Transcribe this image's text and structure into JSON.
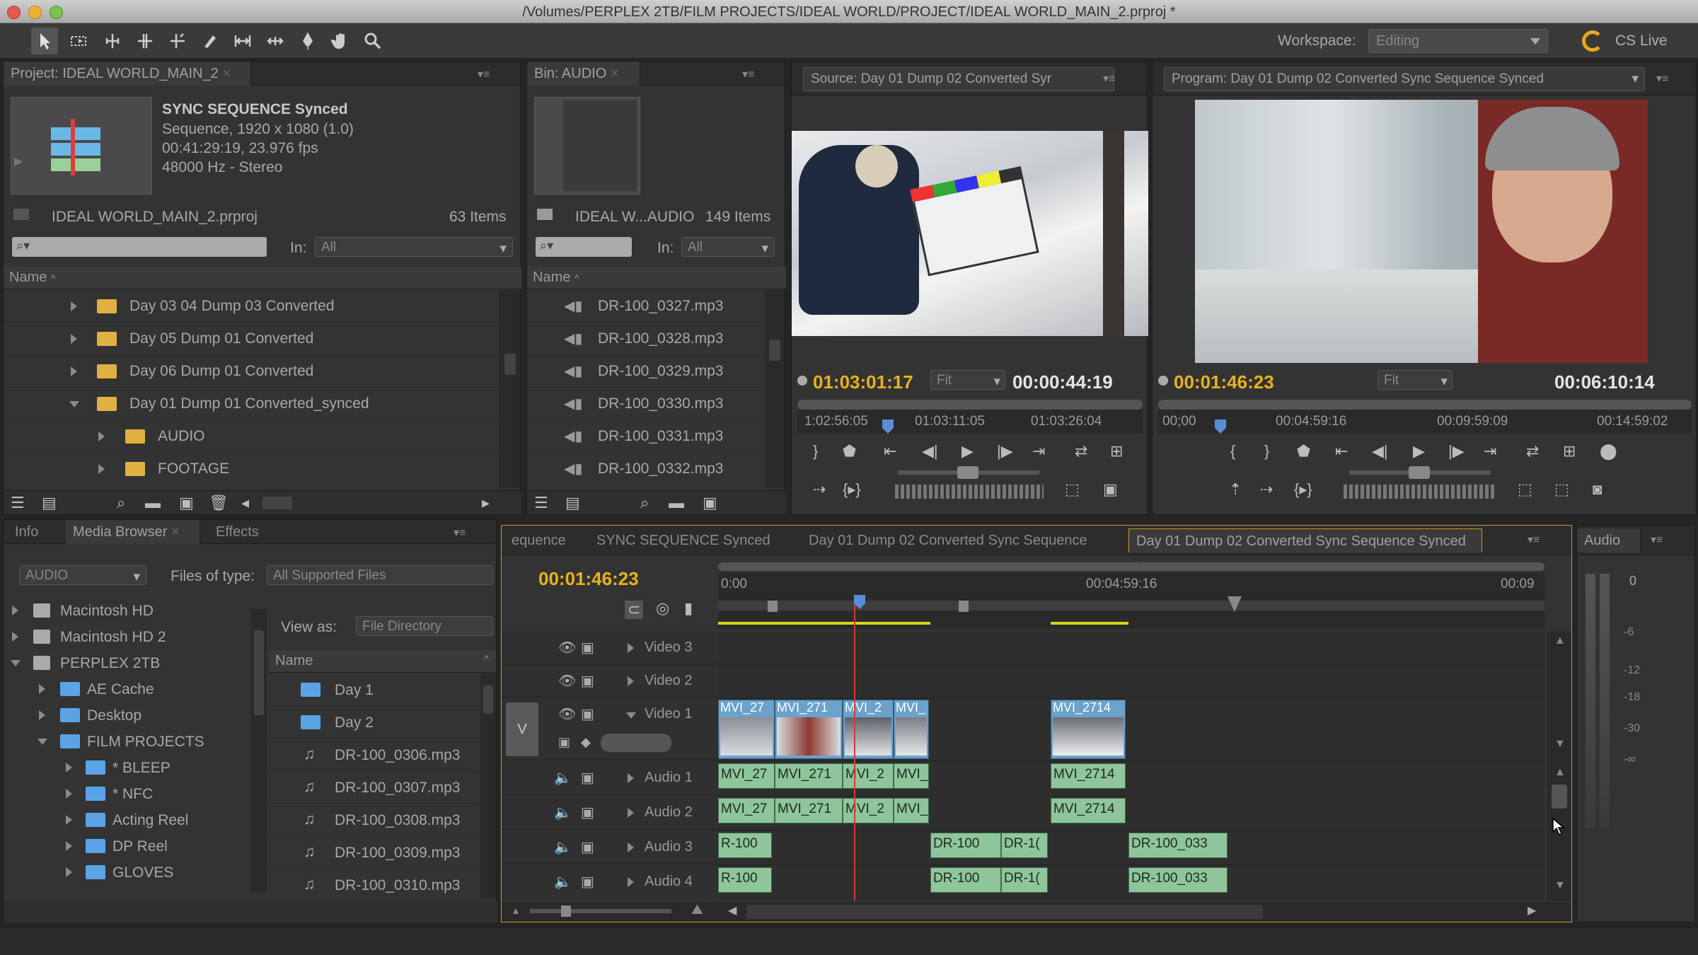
{
  "window": {
    "title": "/Volumes/PERPLEX 2TB/FILM PROJECTS/IDEAL WORLD/PROJECT/IDEAL WORLD_MAIN_2.prproj *"
  },
  "toolbar": {
    "tools": [
      "selection-tool",
      "track-select-tool",
      "ripple-edit-tool",
      "rolling-edit-tool",
      "rate-stretch-tool",
      "razor-tool",
      "slip-tool",
      "slide-tool",
      "pen-tool",
      "hand-tool",
      "zoom-tool"
    ],
    "workspace_label": "Workspace:",
    "workspace_value": "Editing",
    "cslive_label": "CS Live"
  },
  "project": {
    "tab": "Project: IDEAL WORLD_MAIN_2",
    "clip_name": "SYNC SEQUENCE Synced",
    "clip_info_1": "Sequence, 1920 x 1080 (1.0)",
    "clip_info_2": "00:41:29:19, 23.976 fps",
    "clip_info_3": "48000 Hz - Stereo",
    "file_name": "IDEAL WORLD_MAIN_2.prproj",
    "item_count": "63 Items",
    "in_label": "In:",
    "in_value": "All",
    "col_name": "Name",
    "items": [
      {
        "label": "Day 03 04 Dump 03 Converted"
      },
      {
        "label": "Day 05 Dump 01 Converted"
      },
      {
        "label": "Day 06 Dump 01 Converted"
      },
      {
        "label": "Day 01 Dump 01 Converted_synced"
      },
      {
        "label": "AUDIO"
      },
      {
        "label": "FOOTAGE"
      }
    ]
  },
  "bin": {
    "tab": "Bin: AUDIO",
    "file_name": "IDEAL W...AUDIO",
    "item_count": "149 Items",
    "in_label": "In:",
    "in_value": "All",
    "col_name": "Name",
    "items": [
      "DR-100_0327.mp3",
      "DR-100_0328.mp3",
      "DR-100_0329.mp3",
      "DR-100_0330.mp3",
      "DR-100_0331.mp3",
      "DR-100_0332.mp3"
    ]
  },
  "source_monitor": {
    "tab": "Source: Day 01 Dump 02 Converted Syr",
    "timecode": "01:03:01:17",
    "fit": "Fit",
    "duration": "00:0\u0000:44:19",
    "duration_display": "00:00:44:19",
    "ruler": [
      "1:02:56:05",
      "01:03:11:05",
      "01:03:26:04"
    ]
  },
  "program_monitor": {
    "tab": "Program: Day 01 Dump 02 Converted Sync Sequence Synced",
    "timecode": "00:01:46:23",
    "fit": "Fit",
    "duration": "00:06:10:14",
    "ruler": [
      "00;00",
      "00:04:59:16",
      "00:09:59:09",
      "00:14:59:02"
    ]
  },
  "media_browser": {
    "tabs": [
      "Info",
      "Media Browser",
      "Effects"
    ],
    "location": "AUDIO",
    "files_of_type_label": "Files of type:",
    "files_of_type_value": "All Supported Files",
    "view_as_label": "View as:",
    "view_as_value": "File Directory",
    "tree": [
      {
        "label": "Macintosh HD"
      },
      {
        "label": "Macintosh HD 2"
      },
      {
        "label": "PERPLEX 2TB"
      },
      {
        "label": "AE Cache"
      },
      {
        "label": "Desktop"
      },
      {
        "label": "FILM PROJECTS"
      },
      {
        "label": "* BLEEP"
      },
      {
        "label": "* NFC"
      },
      {
        "label": "Acting Reel"
      },
      {
        "label": "DP Reel"
      },
      {
        "label": "GLOVES"
      }
    ],
    "col_name": "Name",
    "files": [
      "Day 1",
      "Day 2",
      "DR-100_0306.mp3",
      "DR-100_0307.mp3",
      "DR-100_0308.mp3",
      "DR-100_0309.mp3",
      "DR-100_0310.mp3"
    ]
  },
  "timeline": {
    "tabs": [
      "equence",
      "SYNC SEQUENCE Synced",
      "Day 01 Dump 02 Converted Sync Sequence",
      "Day 01 Dump 02 Converted Sync Sequence Synced"
    ],
    "timecode": "00:01:46:23",
    "ruler": [
      "0:00",
      "00:04:59:16",
      "00:09"
    ],
    "target_v": "V",
    "tracks": [
      "Video 3",
      "Video 2",
      "Video 1",
      "Audio 1",
      "Audio 2",
      "Audio 3",
      "Audio 4"
    ],
    "video_clips": [
      "MVI_27",
      "MVI_271",
      "MVI_2",
      "MVI_",
      "MVI_2714"
    ],
    "audio1_clips": [
      "MVI_27",
      "MVI_271",
      "MVI_2",
      "MVI_",
      "MVI_2714"
    ],
    "audio2_clips": [
      "MVI_27",
      "MVI_271",
      "MVI_2",
      "MVI_",
      "MVI_2714"
    ],
    "audio3_clips": [
      "R-100",
      "DR-100",
      "DR-1(",
      "DR-100_033"
    ],
    "audio4_clips": [
      "R-100",
      "DR-100",
      "DR-1(",
      "DR-100_033"
    ]
  },
  "audio_meter": {
    "tab": "Audio",
    "scale": [
      "0",
      "-6",
      "-12",
      "-18",
      "-30",
      "-∞"
    ]
  },
  "colors": {
    "accent_timecode": "#e8b21c",
    "video_clip": "#6aa2cc",
    "audio_clip": "#8fc59b",
    "playhead": "#d23a3a"
  }
}
